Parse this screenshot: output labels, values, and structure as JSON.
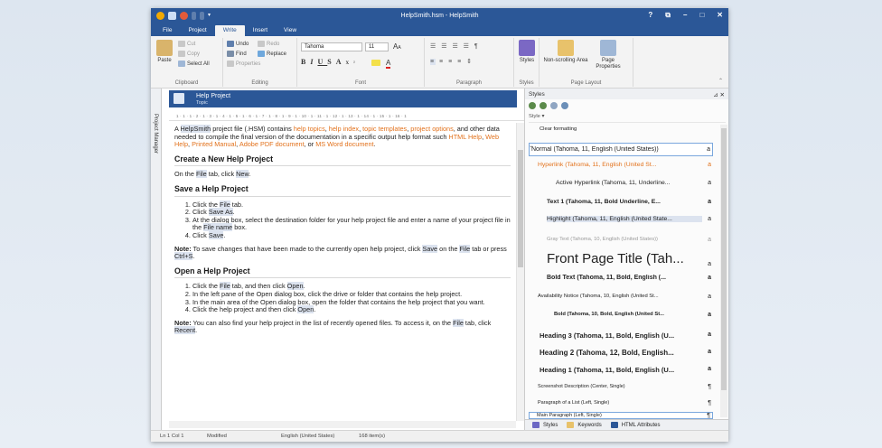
{
  "window": {
    "title": "HelpSmith.hsm - HelpSmith",
    "controls": {
      "help": "?",
      "restore": "⧉",
      "minimize": "–",
      "maximize": "□",
      "close": "✕"
    }
  },
  "ribbon_tabs": [
    "File",
    "Project",
    "Write",
    "Insert",
    "View"
  ],
  "ribbon": {
    "clipboard": {
      "paste": "Paste",
      "cut": "Cut",
      "copy": "Copy",
      "select_all": "Select All",
      "label": "Clipboard"
    },
    "editing": {
      "undo": "Undo",
      "redo": "Redo",
      "find": "Find",
      "replace": "Replace",
      "properties": "Properties",
      "label": "Editing"
    },
    "font": {
      "face": "Tahoma",
      "size": "11",
      "label": "Font"
    },
    "paragraph": {
      "label": "Paragraph"
    },
    "styles": {
      "button": "Styles",
      "label": "Styles"
    },
    "page_layout": {
      "nonscrolling": "Non-scrolling Area",
      "page_props": "Page Properties",
      "label": "Page Layout"
    }
  },
  "sidebar": {
    "label": "Project Manager"
  },
  "topic": {
    "title": "Help Project",
    "subtitle": "Topic"
  },
  "ruler": "1 · 1 · 1 · 2 · 1 · 3 · 1 · 4 · 1 · 5 · 1 · 6 · 1 · 7 · 1 · 8 · 1 · 9 · 1 · 10 · 1 · 11 · 1 · 12 · 1 · 13 · 1 · 14 · 1 · 15 · 1 · 16 · 1",
  "doc": {
    "intro": {
      "a": "A ",
      "helpsmith": "HelpSmith",
      "b": " project file (.HSM) contains ",
      "l1": "help topics",
      "c": ", ",
      "l2": "help index",
      "d": ", ",
      "l3": "topic templates",
      "e": ", ",
      "l4": "project options",
      "f": ", and other data needed to compile the final version of the documentation in a specific output help format such ",
      "l5": "HTML Help",
      "g": ", ",
      "l6": "Web Help",
      "h": ", ",
      "l7": "Printed Manual",
      "i": ", ",
      "l8": "Adobe PDF document",
      "j": ", or ",
      "l9": "MS Word document",
      "k": "."
    },
    "h1": "Create a New Help Project",
    "p1": {
      "a": "On the ",
      "file": "File",
      "b": " tab, click ",
      "new": "New",
      "c": "."
    },
    "h2": "Save a Help Project",
    "save_steps": {
      "s1a": "Click the ",
      "s1b": "File",
      "s1c": " tab.",
      "s2a": "Click ",
      "s2b": "Save As",
      "s2c": ".",
      "s3a": "At the dialog box, select the destination folder for your help project file and enter a name of your project file in the ",
      "s3b": "File name",
      "s3c": " box.",
      "s4a": "Click ",
      "s4b": "Save",
      "s4c": "."
    },
    "note1": {
      "label": "Note:",
      "a": " To save changes that have been made to the currently open help project, click ",
      "save": "Save",
      "b": " on the ",
      "file": "File",
      "c": " tab or press ",
      "ctrl": "Ctrl+S",
      "d": "."
    },
    "h3": "Open a Help Project",
    "open_steps": {
      "s1a": "Click the ",
      "s1b": "File",
      "s1c": " tab, and then click ",
      "s1d": "Open",
      "s1e": ".",
      "s2": "In the left pane of the Open dialog box, click the drive or folder that contains the help project.",
      "s3": "In the main area of the Open dialog box, open the folder that contains the help project that you want.",
      "s4a": "Click the help project and then click ",
      "s4b": "Open",
      "s4c": "."
    },
    "note2": {
      "label": "Note:",
      "a": " You can also find your help project in the list of recently opened files. To access it, on the ",
      "file": "File",
      "b": " tab, click ",
      "recent": "Recent",
      "c": "."
    }
  },
  "status": {
    "pos": "Ln 1 Col 1",
    "modified": "Modified",
    "lang": "English (United States)",
    "items": "168 item(s)"
  },
  "styles_panel": {
    "title": "Styles",
    "pin": "⊿ ✕",
    "combo": "Style",
    "items": [
      {
        "name": "Clear formatting",
        "mark": "",
        "cls": "s0"
      },
      {
        "name": "Normal (Tahoma, 11, English (United States))",
        "mark": "a",
        "cls": "s1"
      },
      {
        "name": "Hyperlink (Tahoma, 11, English (United St...",
        "mark": "a",
        "cls": "s2"
      },
      {
        "name": "Active Hyperlink (Tahoma, 11, Underline...",
        "mark": "a",
        "cls": "s3"
      },
      {
        "name": "Text 1 (Tahoma, 11, Bold Underline, E...",
        "mark": "a",
        "cls": "s4"
      },
      {
        "name": "Highlight (Tahoma, 11, English (United State...",
        "mark": "a",
        "cls": "s5"
      },
      {
        "name": "Gray Text (Tahoma, 10, English (United States))",
        "mark": "a",
        "cls": "s6"
      },
      {
        "name": "Front Page Title (Tah...",
        "mark": "a",
        "cls": "s7"
      },
      {
        "name": "Bold Text (Tahoma, 11, Bold, English (...",
        "mark": "a",
        "cls": "s8"
      },
      {
        "name": "Availability Notice (Tahoma, 10, English (United St...",
        "mark": "a",
        "cls": "s9"
      },
      {
        "name": "Bold (Tahoma, 10, Bold, English (United St...",
        "mark": "a",
        "cls": "s10"
      },
      {
        "name": "Heading 3 (Tahoma, 11, Bold, English (U...",
        "mark": "a",
        "cls": "s11"
      },
      {
        "name": "Heading 2 (Tahoma, 12, Bold, English...",
        "mark": "a",
        "cls": "s12"
      },
      {
        "name": "Heading 1 (Tahoma, 11, Bold, English (U...",
        "mark": "a",
        "cls": "s13"
      },
      {
        "name": "Screenshot Description (Center, Single)",
        "mark": "¶",
        "cls": "s14"
      },
      {
        "name": "Paragraph of a List (Left, Single)",
        "mark": "¶",
        "cls": "s15"
      },
      {
        "name": "Main Paragraph (Left, Single)",
        "mark": "¶",
        "cls": "s16"
      }
    ],
    "tabs": {
      "styles": "Styles",
      "keywords": "Keywords",
      "html": "HTML Attributes"
    }
  },
  "colors": {
    "accent": "#2b5797",
    "link": "#e2711b",
    "highlight": "#dce3ef"
  }
}
